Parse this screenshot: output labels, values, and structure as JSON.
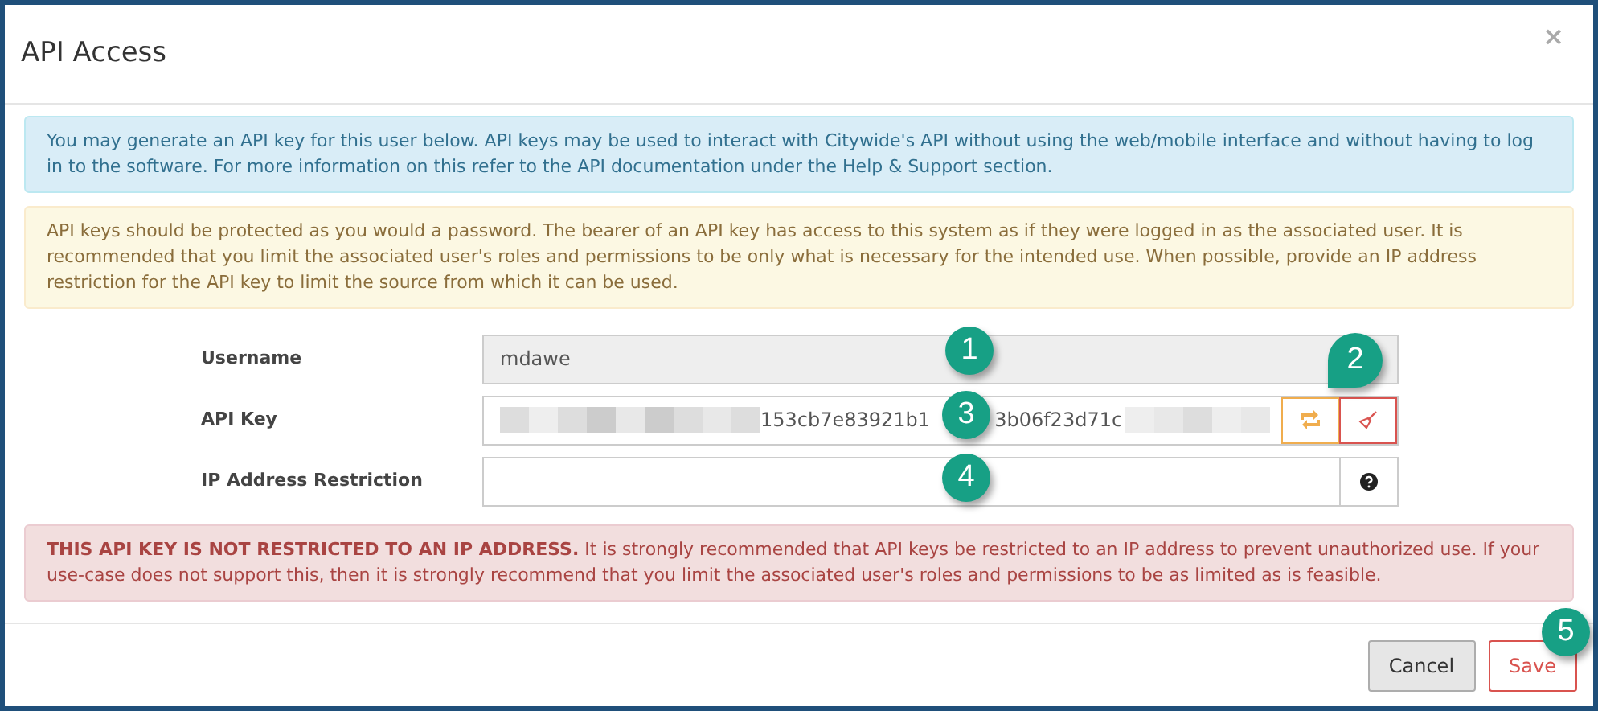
{
  "window": {
    "title": "API Access",
    "close": "×"
  },
  "info_alert": "You may generate an API key for this user below. API keys may be used to interact with Citywide's API without using the web/mobile interface and without having to log in to the software. For more information on this refer to the API documentation under the Help & Support section.",
  "warning_alert": "API keys should be protected as you would a password. The bearer of an API key has access to this system as if they were logged in as the associated user. It is recommended that you limit the associated user's roles and permissions to be only what is necessary for the intended use. When possible, provide an IP address restriction for the API key to limit the source from which it can be used.",
  "fields": [
    {
      "kind": "text",
      "label": "Username",
      "value": "mdawe",
      "disabled": true
    },
    {
      "kind": "apikey",
      "label": "API Key",
      "value_parts": [
        "153cb7e83921b1",
        "3b06f23d71c"
      ]
    },
    {
      "kind": "ip",
      "label": "IP Address Restriction"
    }
  ],
  "danger_alert": "**THIS API KEY IS NOT RESTRICTED TO AN IP ADDRESS.** It is strongly recommended that API keys be restricted to an IP address to prevent unauthorized use. If your use-case does not support this, then it is strongly recommend that you limit the associated user's roles and permissions to be as limited as is feasible.",
  "buttons": [
    {
      "label": "Cancel",
      "kind": "default"
    },
    {
      "label": "Save",
      "kind": "danger"
    }
  ],
  "callouts": [
    "1",
    "2",
    "3",
    "4",
    "5"
  ]
}
